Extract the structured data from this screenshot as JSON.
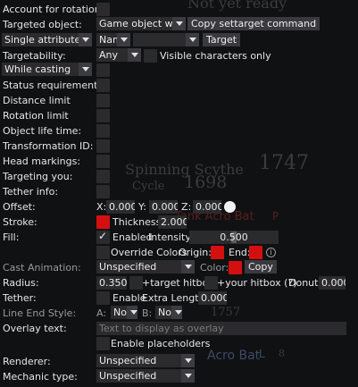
{
  "background_text": {
    "not_ready": "Not yet ready",
    "spinning_scythe": "Spinning Scythe",
    "num_1747": "1747",
    "cycle": "Cycle",
    "num_1698": "1698",
    "num_1757": "1757",
    "name_1": "Tank Acro Bat",
    "name_2": "Acro Bat",
    "aggro_l": "L",
    "aggro_p": "P",
    "num_8": "8"
  },
  "rows": {
    "account_rotation": {
      "label": "Account for rotation:"
    },
    "targeted_object": {
      "label": "Targeted object:",
      "select_value": "Game object with",
      "copy_button": "Copy settarget command"
    },
    "attribute": {
      "select_value": "Single attribute",
      "name_select": "Nam",
      "value_select": "",
      "target_button": "Target"
    },
    "targetability": {
      "label": "Targetability:",
      "select_value": "Any",
      "visible_chars_label": "Visible characters only"
    },
    "casting": {
      "select_value": "While casting"
    },
    "status_requirement": {
      "label": "Status requirement:"
    },
    "distance_limit": {
      "label": "Distance limit"
    },
    "rotation_limit": {
      "label": "Rotation limit"
    },
    "object_life_time": {
      "label": "Object life time:"
    },
    "transformation_id": {
      "label": "Transformation ID:"
    },
    "head_markings": {
      "label": "Head markings:"
    },
    "targeting_you": {
      "label": "Targeting you:"
    },
    "tether_info": {
      "label": "Tether info:"
    },
    "offset": {
      "label": "Offset:",
      "x_label": "X:",
      "x_value": "0.000",
      "y_label": "Y:",
      "y_value": "0.000",
      "z_label": "Z:",
      "z_value": "0.000"
    },
    "stroke": {
      "label": "Stroke:",
      "color": "#d40f0f",
      "thickness_label": "Thickness:",
      "thickness_value": "2.000"
    },
    "fill": {
      "label": "Fill:",
      "enabled_label": "Enabled",
      "intensity_label": "Intensity:",
      "intensity_value": "0.500",
      "intensity_fraction": 0.5
    },
    "override_colors": {
      "label": "Override Colors",
      "origin_label": "Origin:",
      "origin_color": "#d40f0f",
      "end_label": "End:",
      "end_color": "#d40f0f",
      "info_icon": "i"
    },
    "cast_animation": {
      "label": "Cast Animation:",
      "select_value": "Unspecified",
      "color_label": "Color:",
      "color": "#d40f0f",
      "copy_button": "Copy"
    },
    "radius": {
      "label": "Radius:",
      "value": "0.350",
      "target_hitbox_label": "+target hitbox",
      "your_hitbox_label": "+your hitbox (?)",
      "donut_label": "Donut:",
      "donut_value": "0.000"
    },
    "tether": {
      "label": "Tether:",
      "enable_label": "Enable",
      "extra_length_label": "Extra Length:",
      "extra_length_value": "0.000"
    },
    "line_end_style": {
      "label": "Line End Style:",
      "a_label": "A:",
      "a_value": "No",
      "b_label": "B:",
      "b_value": "No"
    },
    "overlay_text": {
      "label": "Overlay text:",
      "placeholder": "Text to display as overlay",
      "placeholders_label": "Enable placeholders"
    },
    "renderer": {
      "label": "Renderer:",
      "select_value": "Unspecified"
    },
    "mechanic_type": {
      "label": "Mechanic type:",
      "select_value": "Unspecified"
    }
  },
  "colors": {
    "accent_red": "#d40f0f",
    "background": "#101113",
    "frame": "#2b2b2e"
  }
}
